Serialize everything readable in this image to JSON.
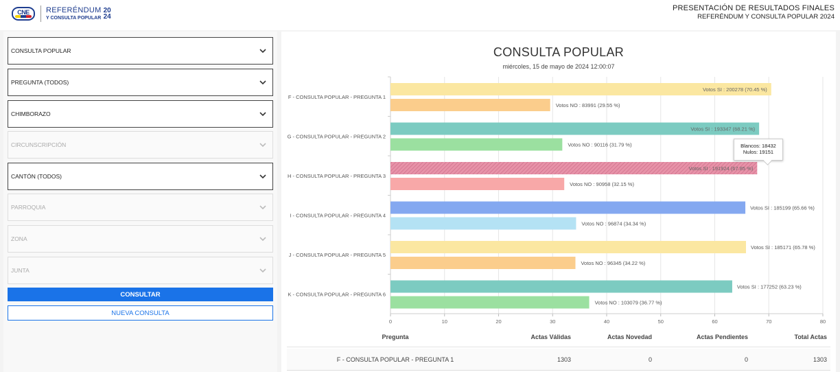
{
  "header": {
    "logo_text": "CNE",
    "brand_line1": "REFERÉNDUM",
    "brand_line2": "Y CONSULTA POPULAR",
    "brand_year": "2024",
    "title": "PRESENTACIÓN DE RESULTADOS FINALES",
    "subtitle": "REFERÉNDUM Y CONSULTA POPULAR 2024"
  },
  "filters": [
    {
      "label": "CONSULTA POPULAR",
      "enabled": true
    },
    {
      "label": "PREGUNTA (TODOS)",
      "enabled": true
    },
    {
      "label": "CHIMBORAZO",
      "enabled": true
    },
    {
      "label": "CIRCUNSCRIPCIÓN",
      "enabled": false
    },
    {
      "label": "CANTÓN (TODOS)",
      "enabled": true
    },
    {
      "label": "PARROQUIA",
      "enabled": false
    },
    {
      "label": "ZONA",
      "enabled": false
    },
    {
      "label": "JUNTA",
      "enabled": false
    }
  ],
  "buttons": {
    "consultar": "CONSULTAR",
    "nueva_consulta": "NUEVA CONSULTA"
  },
  "tooltip": {
    "line1": "Blancos: 18432",
    "line2": "Nulos: 19151"
  },
  "chart_data": {
    "type": "bar",
    "orientation": "horizontal",
    "title": "CONSULTA POPULAR",
    "subtitle": "miércoles, 15 de mayo de 2024 12:00:07",
    "xlim": [
      0,
      80
    ],
    "xticks": [
      0,
      10,
      20,
      30,
      40,
      50,
      60,
      70,
      80
    ],
    "grid": true,
    "categories": [
      "F - CONSULTA POPULAR - PREGUNTA 1",
      "G - CONSULTA POPULAR - PREGUNTA 2",
      "H - CONSULTA POPULAR - PREGUNTA 3",
      "I - CONSULTA POPULAR - PREGUNTA 4",
      "J - CONSULTA POPULAR - PREGUNTA 5",
      "K - CONSULTA POPULAR - PREGUNTA 6"
    ],
    "series": [
      {
        "values": [
          70.45,
          68.21,
          67.85,
          65.66,
          65.78,
          63.23
        ]
      },
      {
        "values": [
          29.55,
          31.79,
          32.15,
          34.34,
          34.22,
          36.77
        ]
      }
    ],
    "bar_labels": [
      [
        "Votos SI : 200278  (70.45 %)",
        "Votos NO : 83991  (29.55 %)"
      ],
      [
        "Votos SI : 193347  (68.21 %)",
        "Votos NO : 90116  (31.79 %)"
      ],
      [
        "Votos SI : 191924  (67.85 %)",
        "Votos NO : 90958  (32.15 %)"
      ],
      [
        "Votos SI : 185199  (65.66 %)",
        "Votos NO : 96874  (34.34 %)"
      ],
      [
        "Votos SI : 185171  (65.78 %)",
        "Votos NO : 96345  (34.22 %)"
      ],
      [
        "Votos SI : 177252  (63.23 %)",
        "Votos NO : 103079  (36.77 %)"
      ]
    ],
    "colors": [
      [
        "#fbe7a1",
        "#fbcd8c"
      ],
      [
        "#7ccbc1",
        "#9be0a0"
      ],
      [
        "#e792a8",
        "#f8a8a8"
      ],
      [
        "#84a8f0",
        "#b4e2f4"
      ],
      [
        "#fbe7a1",
        "#fbcd8c"
      ],
      [
        "#7ccbc1",
        "#9be0a0"
      ]
    ],
    "highlighted_index": 2
  },
  "table": {
    "headers": [
      "Pregunta",
      "Actas Válidas",
      "Actas Novedad",
      "Actas Pendientes",
      "Total Actas"
    ],
    "rows": [
      [
        "F - CONSULTA POPULAR - PREGUNTA 1",
        "1303",
        "0",
        "0",
        "1303"
      ]
    ]
  }
}
